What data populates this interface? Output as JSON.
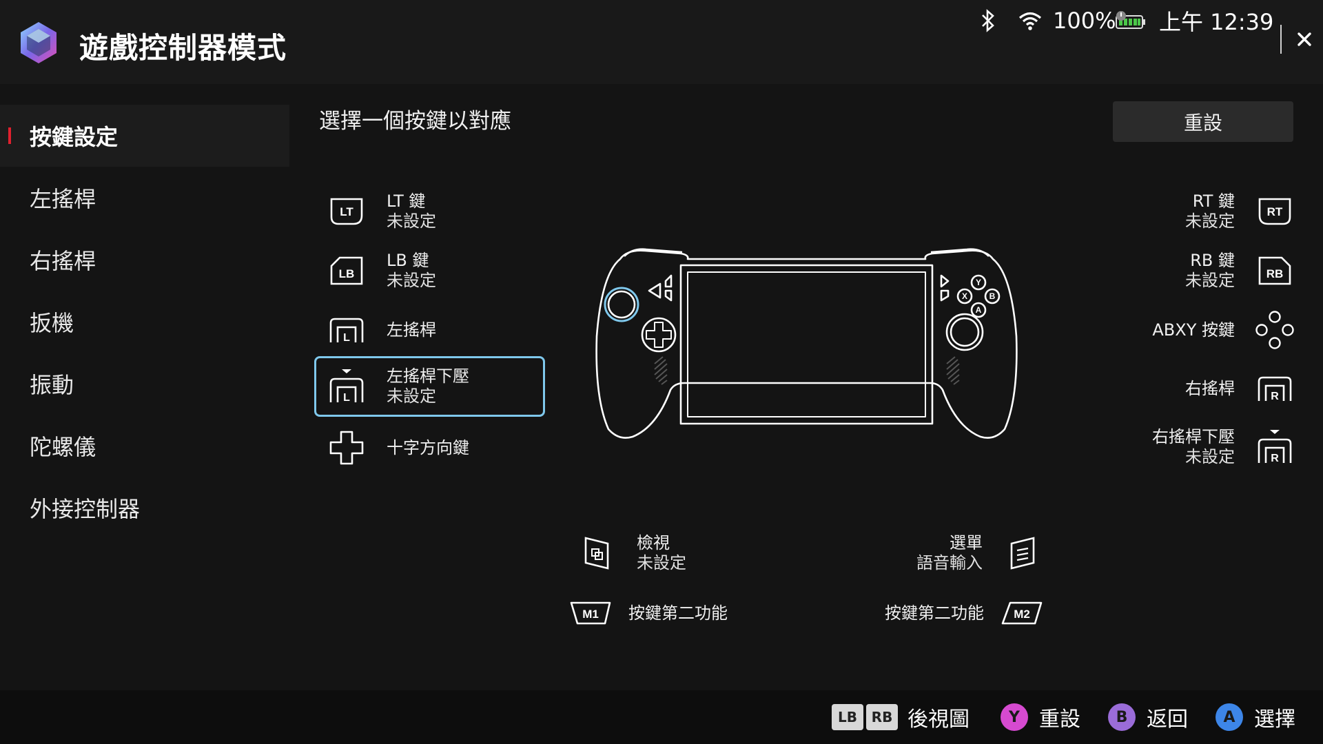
{
  "header": {
    "title": "遊戲控制器模式",
    "battery_percent": "100%",
    "time": "上午 12:39"
  },
  "sidebar": {
    "items": [
      {
        "label": "按鍵設定",
        "active": true
      },
      {
        "label": "左搖桿"
      },
      {
        "label": "右搖桿"
      },
      {
        "label": "扳機"
      },
      {
        "label": "振動"
      },
      {
        "label": "陀螺儀"
      },
      {
        "label": "外接控制器"
      }
    ]
  },
  "content": {
    "heading": "選擇一個按鍵以對應",
    "reset_label": "重設"
  },
  "left_buttons": [
    {
      "name": "LT 鍵",
      "status": "未設定",
      "icon": "lt-icon"
    },
    {
      "name": "LB 鍵",
      "status": "未設定",
      "icon": "lb-icon"
    },
    {
      "name": "左搖桿",
      "icon": "left-stick-icon"
    },
    {
      "name": "左搖桿下壓",
      "status": "未設定",
      "icon": "left-stick-press-icon",
      "selected": true
    },
    {
      "name": "十字方向鍵",
      "icon": "dpad-icon"
    }
  ],
  "right_buttons": [
    {
      "name": "RT 鍵",
      "status": "未設定",
      "icon": "rt-icon"
    },
    {
      "name": "RB 鍵",
      "status": "未設定",
      "icon": "rb-icon"
    },
    {
      "name": "ABXY 按鍵",
      "icon": "abxy-icon"
    },
    {
      "name": "右搖桿",
      "icon": "right-stick-icon"
    },
    {
      "name": "右搖桿下壓",
      "status": "未設定",
      "icon": "right-stick-press-icon"
    }
  ],
  "bottom_buttons": {
    "view": {
      "name": "檢視",
      "status": "未設定"
    },
    "menu": {
      "name": "選單",
      "status": "語音輸入"
    },
    "m1": {
      "label": "按鍵第二功能",
      "badge": "M1"
    },
    "m2": {
      "label": "按鍵第二功能",
      "badge": "M2"
    }
  },
  "icon_letters": {
    "lt": "LT",
    "lb": "LB",
    "rt": "RT",
    "rb": "RB",
    "l": "L",
    "r": "R"
  },
  "footer": {
    "lb": "LB",
    "rb": "RB",
    "rear_view_label": "後視圖",
    "y_key": "Y",
    "y_label": "重設",
    "b_key": "B",
    "b_label": "返回",
    "a_key": "A",
    "a_label": "選擇"
  },
  "colors": {
    "accent_red": "#e0202e",
    "selection_blue": "#7fc8ec",
    "y_button": "#d64ad0",
    "b_button": "#9a6cd8",
    "a_button": "#3d86e8",
    "battery_green": "#4cc84a"
  }
}
